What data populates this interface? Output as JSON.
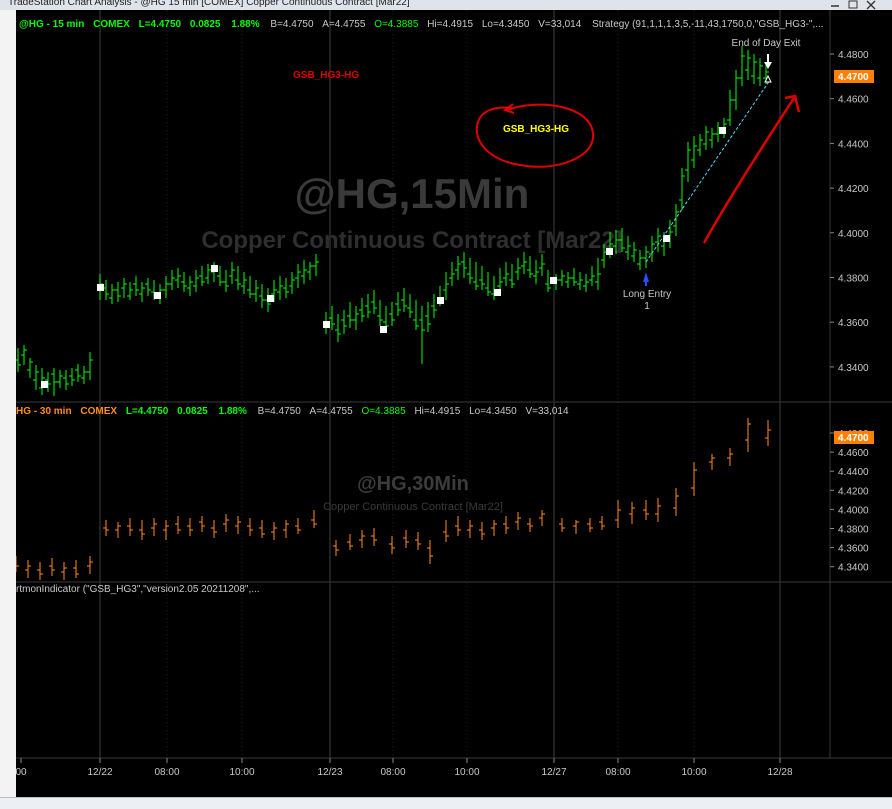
{
  "window": {
    "title": "TradeStation Chart Analysis - @HG 15 min [COMEX] Copper Continuous Contract [Mar22]"
  },
  "pane1": {
    "header": {
      "symbol": "@HG - 15 min",
      "exchange": "COMEX",
      "last": "L=4.4750",
      "change": "0.0825",
      "pct": "1.88%",
      "bid": "B=4.4750",
      "ask": "A=4.4755",
      "open": "O=4.3885",
      "high": "Hi=4.4915",
      "low": "Lo=4.3450",
      "volume": "V=33,014",
      "strategy": "Strategy (91,1,1,1,3,5,-11,43,1750,0,\"GSB_HG3-\",..."
    },
    "watermark_title": "@HG,15Min",
    "watermark_subtitle": "Copper Continuous Contract [Mar22]",
    "label_red": "GSB_HG3-HG",
    "label_yellow": "GSB_HG3-HG",
    "entry_label": "Long Entry",
    "entry_number": "1",
    "exit_label": "End of Day Exit",
    "price_marker": "4.4700",
    "axis_ticks": [
      "4.4800",
      "4.4600",
      "4.4400",
      "4.4200",
      "4.4000",
      "4.3800",
      "4.3600",
      "4.3400"
    ]
  },
  "pane2": {
    "header": {
      "symbol": "HG - 30 min",
      "exchange": "COMEX",
      "last": "L=4.4750",
      "change": "0.0825",
      "pct": "1.88%",
      "bid": "B=4.4750",
      "ask": "A=4.4755",
      "open": "O=4.3885",
      "high": "Hi=4.4915",
      "low": "Lo=4.3450",
      "volume": "V=33,014"
    },
    "watermark_title": "@HG,30Min",
    "watermark_subtitle": "Copper Continuous Contract [Mar22]",
    "price_marker": "4.4700",
    "axis_ticks": [
      "4.4800",
      "4.4600",
      "4.4400",
      "4.4200",
      "4.4000",
      "4.3800",
      "4.3600",
      "4.3400"
    ]
  },
  "pane3": {
    "indicator": "rtmonIndicator (\"GSB_HG3\",\"version2.05 20211208\",..."
  },
  "time_axis": [
    "00",
    "12/22",
    "08:00",
    "10:00",
    "12/23",
    "08:00",
    "10:00",
    "12/27",
    "08:00",
    "10:00",
    "12/28"
  ],
  "colors": {
    "background": "#000000",
    "bar_up_15": "#00ff00",
    "bar_30": "#ff8c1a",
    "annotation_red": "#e00000",
    "label_yellow": "#ffff00",
    "price_marker_bg": "#ff8000"
  },
  "chart_data": [
    {
      "type": "ohlc-bar",
      "title": "@HG,15Min",
      "y_range": [
        4.33,
        4.49
      ],
      "ticks": [
        4.48,
        4.46,
        4.44,
        4.42,
        4.4,
        4.38,
        4.36,
        4.34
      ],
      "last_price": 4.47,
      "trade": {
        "entry": "Long Entry 1",
        "exit": "End of Day Exit"
      }
    },
    {
      "type": "ohlc-bar",
      "title": "@HG,30Min",
      "y_range": [
        4.33,
        4.49
      ],
      "ticks": [
        4.48,
        4.46,
        4.44,
        4.42,
        4.4,
        4.38,
        4.36,
        4.34
      ],
      "last_price": 4.47
    }
  ]
}
